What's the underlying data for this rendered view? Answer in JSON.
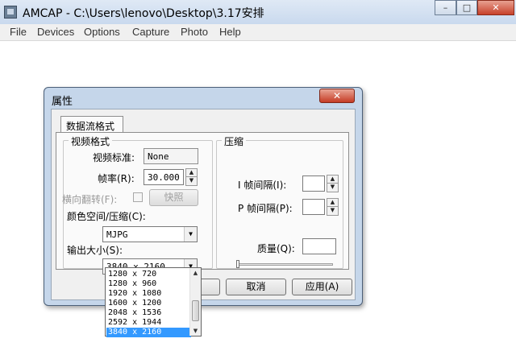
{
  "app": {
    "title": "AMCAP - C:\\Users\\lenovo\\Desktop\\3.17安排",
    "menu": [
      "File",
      "Devices",
      "Options",
      "Capture",
      "Photo",
      "Help"
    ],
    "controls": {
      "minimize": "–",
      "maximize": "□",
      "close": "✕"
    }
  },
  "dialog": {
    "title": "属性",
    "close_glyph": "✕",
    "tab": "数据流格式",
    "video_format": {
      "group_title": "视频格式",
      "standard_label": "视频标准:",
      "standard_value": "None",
      "framerate_label": "帧率(R):",
      "framerate_value": "30.000",
      "flip_label": "横向翻转(F):",
      "snapshot_label": "快照",
      "colorspace_label": "颜色空间/压缩(C):",
      "colorspace_value": "MJPG",
      "output_size_label": "输出大小(S):",
      "output_size_value": "3840 x 2160"
    },
    "compression": {
      "group_title": "压缩",
      "i_interval_label": "I 帧间隔(I):",
      "p_interval_label": "P 帧间隔(P):",
      "quality_label": "质量(Q):"
    },
    "buttons": {
      "cancel": "取消",
      "apply": "应用(A)"
    }
  },
  "dropdown": {
    "options": [
      "1280 x 720",
      "1280 x 960",
      "1920 x 1080",
      "1600 x 1200",
      "2048 x 1536",
      "2592 x 1944",
      "3840 x 2160"
    ],
    "selected": "3840 x 2160"
  },
  "icons": {
    "spin_up": "▲",
    "spin_down": "▼",
    "combo_arrow": "▼",
    "scroll_up": "▲",
    "scroll_down": "▼"
  },
  "colors": {
    "selection": "#3399ff",
    "close_button": "#c53b24",
    "dialog_frame": "#c5d6ea"
  }
}
